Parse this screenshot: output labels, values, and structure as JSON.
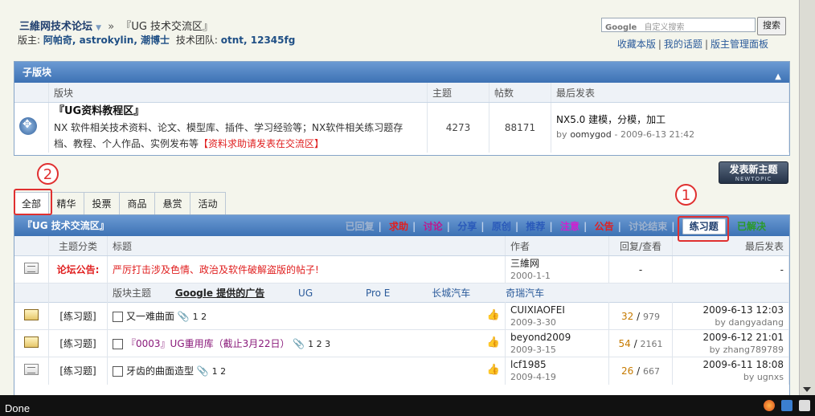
{
  "header": {
    "forum_name": "三維网技术论坛",
    "breadcrumb_sep": "»",
    "section": "『UG 技术交流区』",
    "moderators_label": "版主:",
    "moderators": "阿帕奇, astrokylin, 潮博士",
    "team_label": "技术团队:",
    "team": "otnt, 12345fg"
  },
  "search": {
    "placeholder": "自定义搜索",
    "brand": "Google",
    "button": "搜索"
  },
  "toplinks": [
    "收藏本版",
    "我的话题",
    "版主管理面板"
  ],
  "subforum": {
    "title": "子版块",
    "columns": [
      "版块",
      "主题",
      "帖数",
      "最后发表"
    ],
    "row": {
      "name": "『UG资料教程区』",
      "desc": "NX 软件相关技术资料、论文、模型库、插件、学习经验等；NX软件相关练习题存档、教程、个人作品、实例发布等",
      "desc_red": "【资料求助请发表在交流区】",
      "topics": "4273",
      "posts": "88171",
      "last_title": "NX5.0 建模，分模，加工",
      "last_by": "by",
      "last_user": "oomygod",
      "last_time": "- 2009-6-13 21:42"
    }
  },
  "new_topic": {
    "label": "发表新主题",
    "sub": "NEWTOPIC"
  },
  "tabs": [
    "全部",
    "精华",
    "投票",
    "商品",
    "悬赏",
    "活动"
  ],
  "annotations": {
    "one": "1",
    "two": "2"
  },
  "main": {
    "title": "『UG 技术交流区』",
    "types": [
      {
        "label": "已回复",
        "color": "#9fb3ce"
      },
      {
        "label": "求助",
        "color": "#e02020"
      },
      {
        "label": "讨论",
        "color": "#c0168d"
      },
      {
        "label": "分享",
        "color": "#2a5aba"
      },
      {
        "label": "原创",
        "color": "#2a5aba"
      },
      {
        "label": "推荐",
        "color": "#2a5aba"
      },
      {
        "label": "注意",
        "color": "#d020d0"
      },
      {
        "label": "公告",
        "color": "#e02020"
      },
      {
        "label": "讨论结束",
        "color": "#9fb3ce"
      }
    ],
    "selected_type": "练习题",
    "solved_type": "已解决",
    "columns": [
      "主题分类",
      "标题",
      "作者",
      "回复/查看",
      "最后发表"
    ],
    "announce": {
      "label": "论坛公告:",
      "text": "严厉打击涉及色情、政治及软件破解盗版的帖子!",
      "author": "三維网",
      "date": "2000-1-1",
      "replies": "-",
      "last": "-"
    },
    "ads": {
      "label": "版块主题",
      "google": "Google 提供的广告",
      "links": [
        "UG",
        "Pro E",
        "长城汽车",
        "奇瑞汽车"
      ]
    },
    "threads": [
      {
        "cat": "[练习题]",
        "title": "又一难曲面",
        "pages": "1  2",
        "author": "CUIXIAOFEI",
        "date": "2009-3-30",
        "replies": "32",
        "views": "979",
        "last_time": "2009-6-13 12:03",
        "last_user": "by dangyadang",
        "title_color": "#222"
      },
      {
        "cat": "[练习题]",
        "title": "『0003』UG重用库（截止3月22日）",
        "pages": "1  2  3",
        "author": "beyond2009",
        "date": "2009-3-15",
        "replies": "54",
        "views": "2161",
        "last_time": "2009-6-12 21:01",
        "last_user": "by zhang789789",
        "title_color": "#8a1a7a"
      },
      {
        "cat": "[练习题]",
        "title": "牙齿的曲面造型",
        "pages": "1  2",
        "author": "lcf1985",
        "date": "2009-4-19",
        "replies": "26",
        "views": "667",
        "last_time": "2009-6-11 18:08",
        "last_user": "by ugnxs",
        "title_color": "#222"
      }
    ]
  },
  "status": {
    "text": "Done"
  }
}
